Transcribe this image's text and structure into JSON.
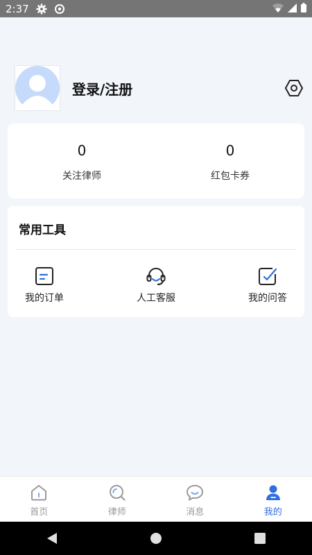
{
  "status_bar": {
    "time": "2:37",
    "icons": [
      "settings-icon",
      "sync-icon",
      "wifi-icon",
      "signal-icon",
      "battery-icon"
    ]
  },
  "profile": {
    "login_label": "登录/注册",
    "avatar_icon": "default-avatar",
    "settings_icon": "hexagon-settings-icon"
  },
  "stats": [
    {
      "value": "0",
      "label": "关注律师"
    },
    {
      "value": "0",
      "label": "红包卡券"
    }
  ],
  "tools": {
    "title": "常用工具",
    "items": [
      {
        "label": "我的订单",
        "icon": "order-icon"
      },
      {
        "label": "人工客服",
        "icon": "headset-icon"
      },
      {
        "label": "我的问答",
        "icon": "qa-check-icon"
      }
    ]
  },
  "tabbar": {
    "items": [
      {
        "label": "首页",
        "icon": "home-icon"
      },
      {
        "label": "律师",
        "icon": "lawyer-icon"
      },
      {
        "label": "消息",
        "icon": "message-icon"
      },
      {
        "label": "我的",
        "icon": "user-icon",
        "active": true
      }
    ],
    "active_color": "#2f6fe0",
    "inactive_color": "#9a9a9a"
  },
  "colors": {
    "accent": "#2f6fe0",
    "background": "#f2f5fa",
    "avatar": "#c6dbfb"
  }
}
